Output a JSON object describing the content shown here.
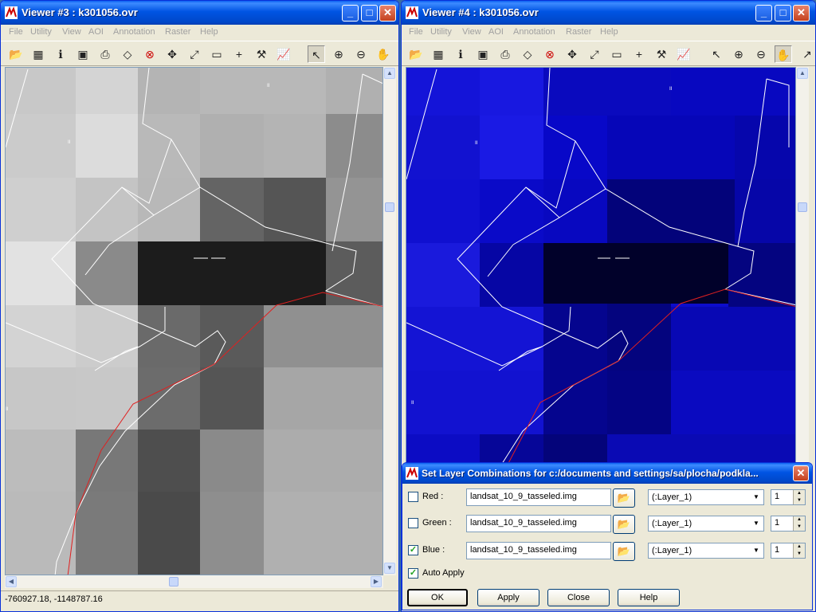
{
  "viewer3": {
    "title": "Viewer #3 : k301056.ovr",
    "menus": [
      "File",
      "Utility",
      "View",
      "AOI",
      "Annotation",
      "Raster",
      "Help"
    ],
    "status_coords": "-760927.18, -1148787.16"
  },
  "viewer4": {
    "title": "Viewer #4 : k301056.ovr",
    "menus": [
      "File",
      "Utility",
      "View",
      "AOI",
      "Annotation",
      "Raster",
      "Help"
    ]
  },
  "toolbar_icons": [
    "open-folder-icon",
    "open-layer-icon",
    "info-icon",
    "save-icon",
    "print-icon",
    "eraser-icon",
    "clear-icon",
    "fit-extent-icon",
    "expand-icon",
    "measure-icon",
    "crosshair-icon",
    "hammer-icon",
    "profile-icon",
    "pointer-icon",
    "zoom-in-icon",
    "zoom-out-icon",
    "pan-hand-icon"
  ],
  "map_labels": [
    "II",
    "II",
    "II",
    "II"
  ],
  "dialog": {
    "title": "Set Layer Combinations for c:/documents and settings/sa/plocha/podkla...",
    "rows": [
      {
        "label": "Red :",
        "checked": false,
        "file": "landsat_10_9_tasseled.img",
        "layer": "(:Layer_1)",
        "value": "1"
      },
      {
        "label": "Green :",
        "checked": false,
        "file": "landsat_10_9_tasseled.img",
        "layer": "(:Layer_1)",
        "value": "1"
      },
      {
        "label": "Blue :",
        "checked": true,
        "file": "landsat_10_9_tasseled.img",
        "layer": "(:Layer_1)",
        "value": "1"
      }
    ],
    "auto_apply_label": "Auto Apply",
    "auto_apply_checked": true,
    "buttons": {
      "ok": "OK",
      "apply": "Apply",
      "close": "Close",
      "help": "Help"
    }
  },
  "colors": {
    "title_blue": "#0054e3",
    "polygon_white": "#ffffff",
    "boundary_red": "#e02020",
    "raster_blue": "#1a1ae8"
  }
}
